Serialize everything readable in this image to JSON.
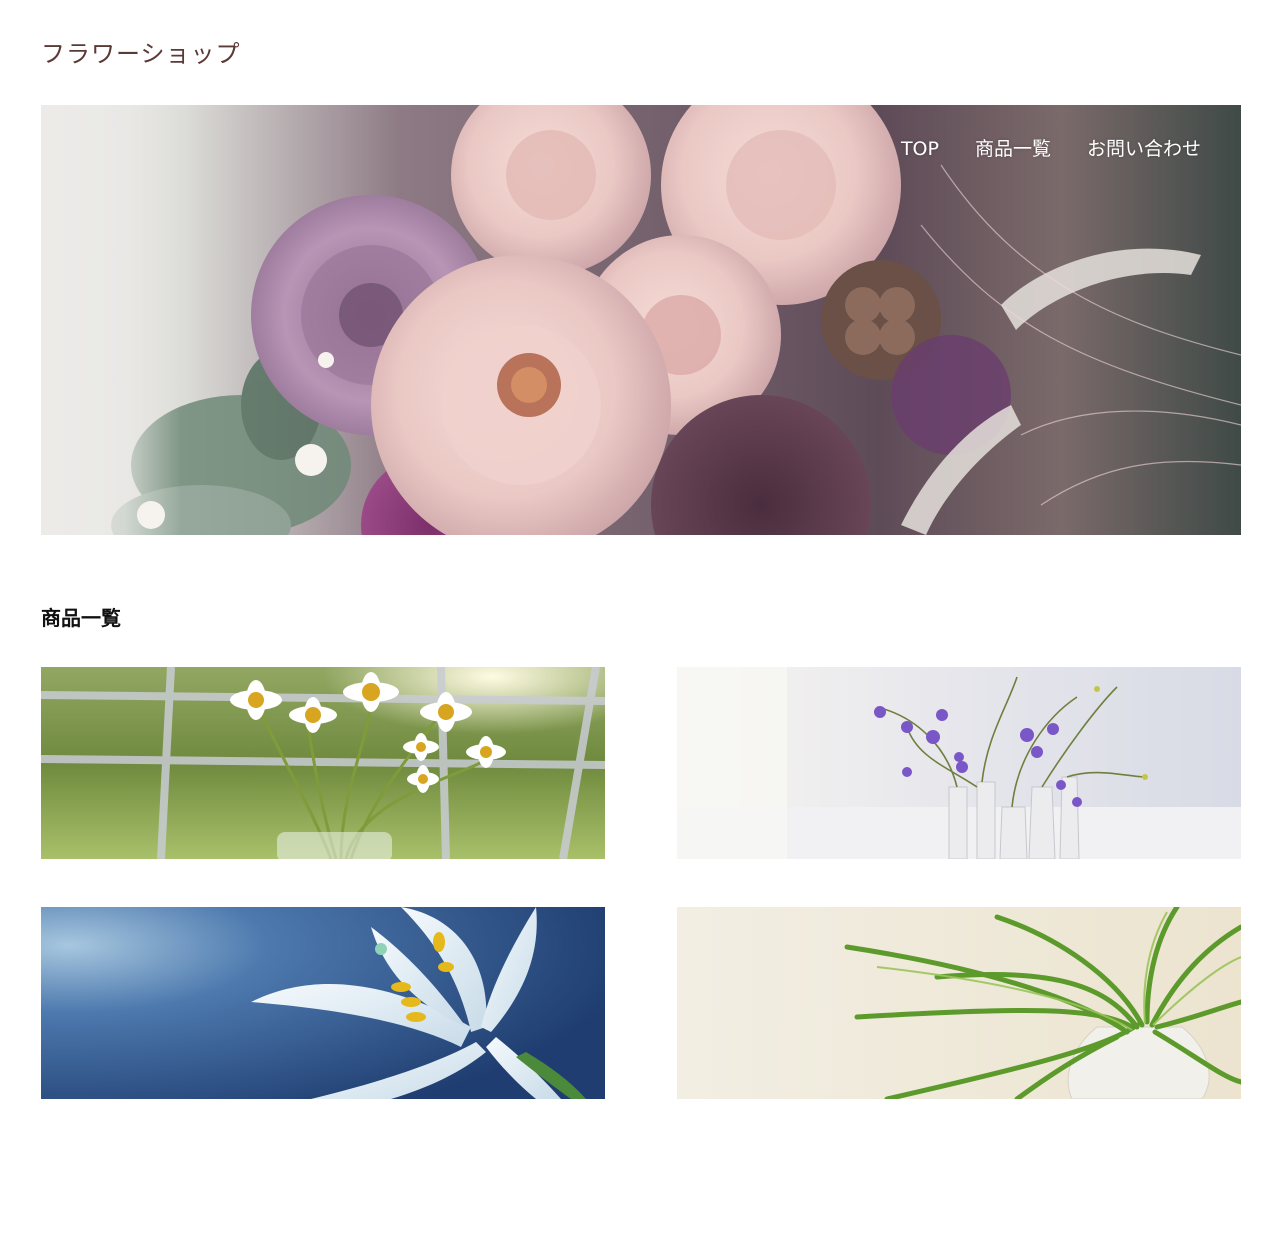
{
  "header": {
    "site_title": "フラワーショップ"
  },
  "nav": {
    "items": [
      {
        "label": "TOP"
      },
      {
        "label": "商品一覧"
      },
      {
        "label": "お問い合わせ"
      }
    ]
  },
  "products_section": {
    "heading": "商品一覧",
    "items": [
      {
        "image": "daisies-in-glass-vase-photo"
      },
      {
        "image": "bellflowers-in-white-vases-photo"
      },
      {
        "image": "white-lily-on-blue-photo"
      },
      {
        "image": "green-plant-in-white-vase-photo"
      }
    ]
  },
  "hero": {
    "image": "rose-bouquet-photo"
  },
  "colors": {
    "title": "#5b3a36",
    "nav_text": "#ffffff",
    "heading": "#111111",
    "background": "#ffffff"
  }
}
